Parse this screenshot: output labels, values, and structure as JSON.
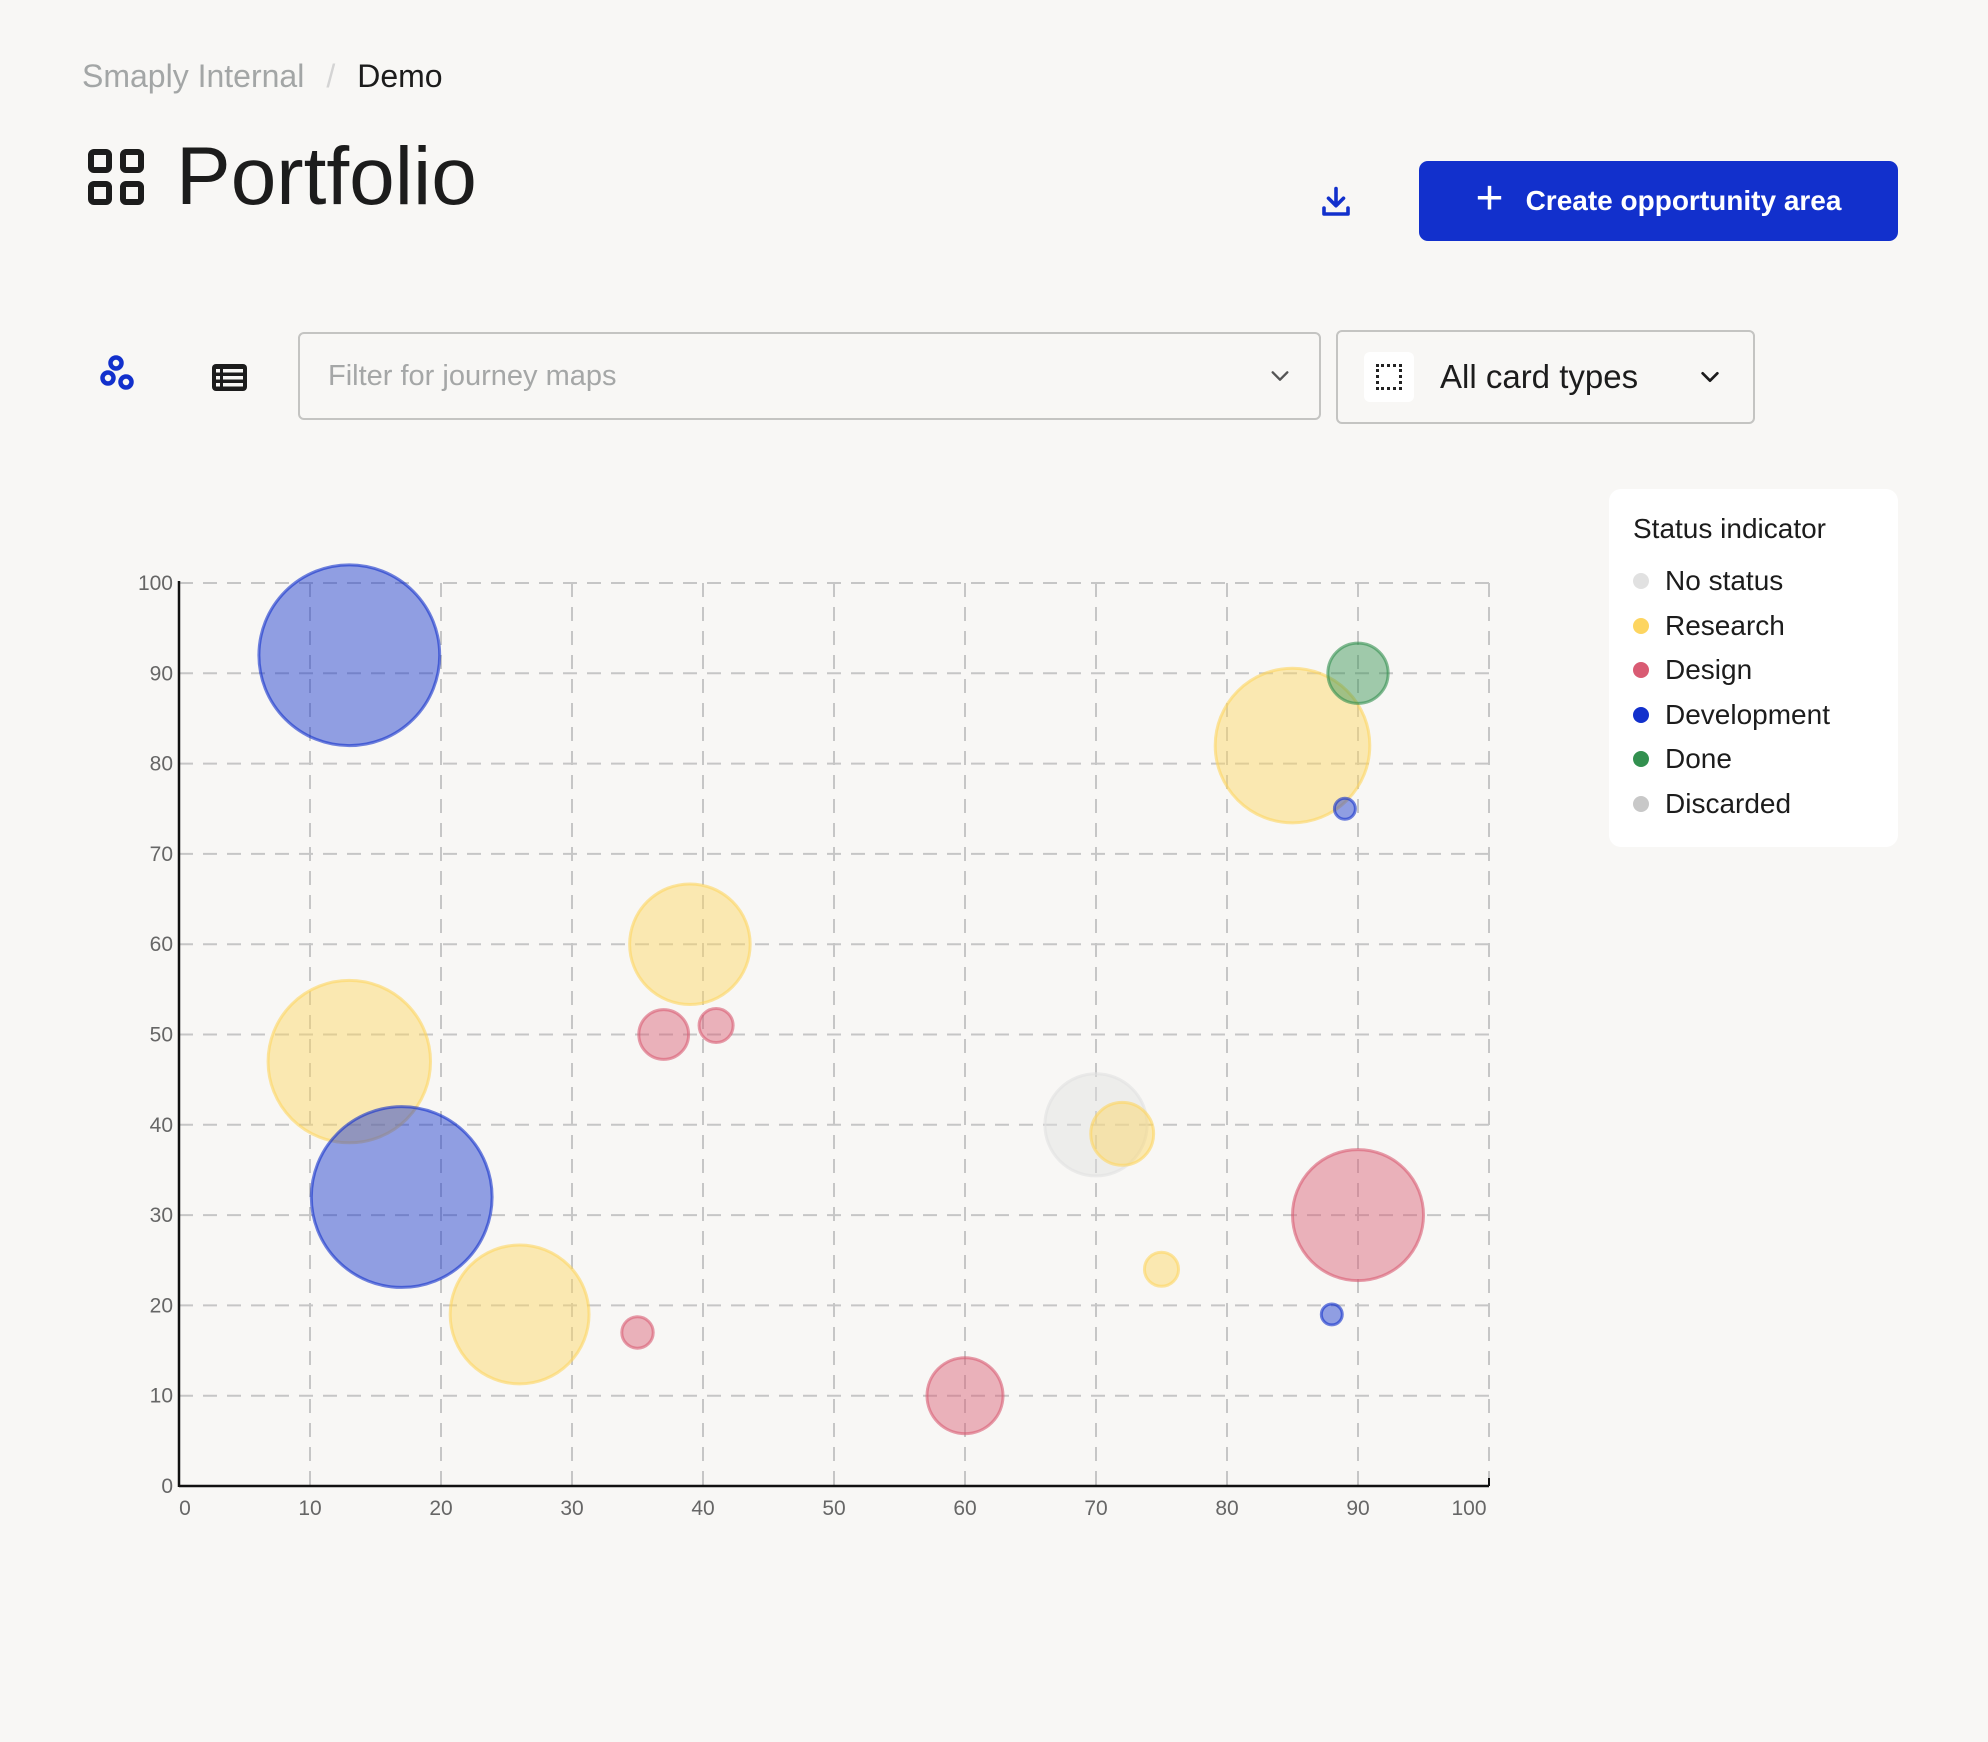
{
  "breadcrumb": {
    "parent": "Smaply Internal",
    "separator": "/",
    "current": "Demo"
  },
  "page": {
    "title": "Portfolio",
    "title_icon": "grid-icon"
  },
  "toolbar": {
    "download_icon": "download-icon",
    "create_button_label": "Create opportunity area",
    "create_button_icon": "plus-icon",
    "brand_color": "#1230cc"
  },
  "view_switcher": [
    {
      "name": "bubble-view",
      "icon": "bubbles-icon",
      "active": true
    },
    {
      "name": "list-view",
      "icon": "list-icon",
      "active": false
    }
  ],
  "filters": {
    "journey_maps_placeholder": "Filter for journey maps",
    "card_type_selected": "All card types"
  },
  "legend": {
    "title": "Status indicator",
    "items": [
      {
        "label": "No status",
        "color": "#e1e1e1"
      },
      {
        "label": "Research",
        "color": "#fdd560"
      },
      {
        "label": "Design",
        "color": "#d95b73"
      },
      {
        "label": "Development",
        "color": "#1230cc"
      },
      {
        "label": "Done",
        "color": "#32904f"
      },
      {
        "label": "Discarded",
        "color": "#c8c8c8"
      }
    ]
  },
  "chart_data": {
    "type": "scatter",
    "subtype": "bubble",
    "title": "",
    "xlabel": "",
    "ylabel": "",
    "xlim": [
      0,
      100
    ],
    "ylim": [
      0,
      100
    ],
    "x_ticks": [
      0,
      10,
      20,
      30,
      40,
      50,
      60,
      70,
      80,
      90,
      100
    ],
    "y_ticks": [
      0,
      10,
      20,
      30,
      40,
      50,
      60,
      70,
      80,
      90,
      100
    ],
    "grid": true,
    "legend_position": "right",
    "size_unit": "bubble radius in x-axis units",
    "points": [
      {
        "x": 13,
        "y": 92,
        "size": 6.9,
        "status": "Development"
      },
      {
        "x": 13,
        "y": 47,
        "size": 6.2,
        "status": "Research"
      },
      {
        "x": 17,
        "y": 32,
        "size": 6.9,
        "status": "Development"
      },
      {
        "x": 26,
        "y": 19,
        "size": 5.3,
        "status": "Research"
      },
      {
        "x": 35,
        "y": 17,
        "size": 1.2,
        "status": "Design"
      },
      {
        "x": 39,
        "y": 60,
        "size": 4.6,
        "status": "Research"
      },
      {
        "x": 37,
        "y": 50,
        "size": 1.9,
        "status": "Design"
      },
      {
        "x": 41,
        "y": 51,
        "size": 1.3,
        "status": "Design"
      },
      {
        "x": 60,
        "y": 10,
        "size": 2.9,
        "status": "Design"
      },
      {
        "x": 70,
        "y": 40,
        "size": 3.9,
        "status": "No status"
      },
      {
        "x": 72,
        "y": 39,
        "size": 2.4,
        "status": "Research"
      },
      {
        "x": 75,
        "y": 24,
        "size": 1.3,
        "status": "Research"
      },
      {
        "x": 85,
        "y": 82,
        "size": 5.9,
        "status": "Research"
      },
      {
        "x": 90,
        "y": 90,
        "size": 2.3,
        "status": "Done"
      },
      {
        "x": 89,
        "y": 75,
        "size": 0.8,
        "status": "Development"
      },
      {
        "x": 90,
        "y": 30,
        "size": 5.0,
        "status": "Design"
      },
      {
        "x": 88,
        "y": 19,
        "size": 0.8,
        "status": "Development"
      }
    ]
  }
}
